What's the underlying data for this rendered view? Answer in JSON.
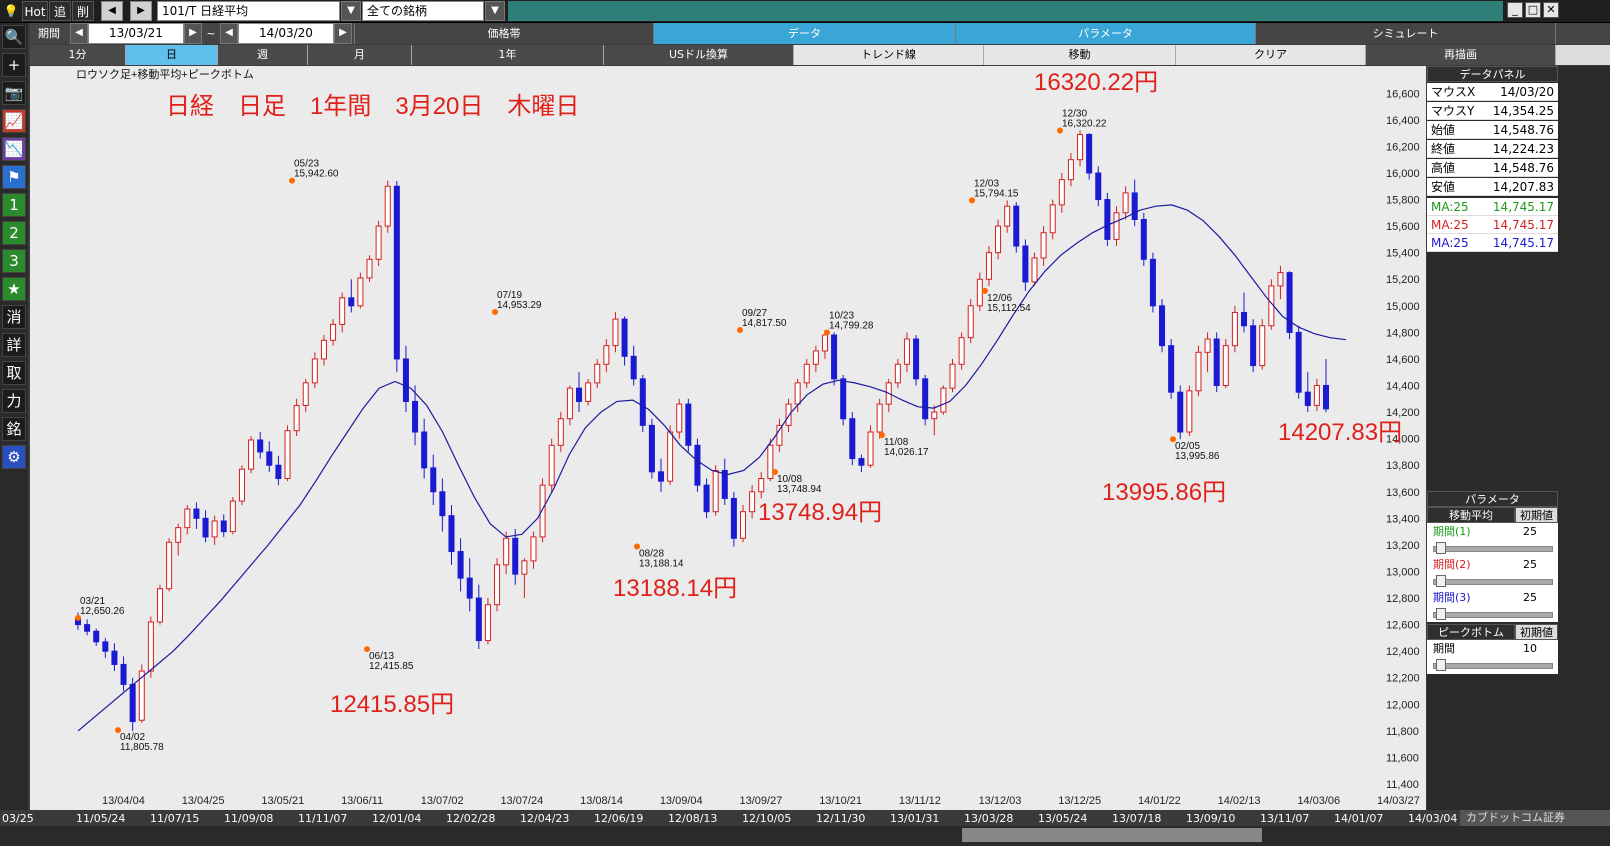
{
  "topbar": {
    "hot": "Hot",
    "add": "追",
    "del": "削",
    "symbol": "101/T 日経平均",
    "universe": "全ての銘柄"
  },
  "row2": {
    "period_label": "期間",
    "date_from": "13/03/21",
    "tilde": "~",
    "date_to": "14/03/20",
    "tabs": [
      "価格帯",
      "データ",
      "パラメータ",
      "シミュレート"
    ]
  },
  "row3": {
    "tabs": [
      "1分",
      "日",
      "週",
      "月",
      "1年",
      "USドル換算",
      "トレンド線",
      "移動",
      "クリア",
      "再描画"
    ]
  },
  "lefttool": {
    "buttons": [
      "search-icon",
      "plus-icon",
      "camera-icon",
      "chart-icon",
      "chart2-icon",
      "flag-icon",
      "1",
      "2",
      "3",
      "★",
      "消",
      "詳",
      "取",
      "力",
      "銘",
      "gear-icon"
    ]
  },
  "chart_data": {
    "type": "candlestick",
    "title": "ロウソク足+移動平均+ピークボトム",
    "headline": "日経　日足　1年間　3月20日　木曜日",
    "ylim": [
      11400,
      16700
    ],
    "y_ticks": [
      11400,
      11600,
      11800,
      12000,
      12200,
      12400,
      12600,
      12800,
      13000,
      13200,
      13400,
      13600,
      13800,
      14000,
      14200,
      14400,
      14600,
      14800,
      15000,
      15200,
      15400,
      15600,
      15800,
      16000,
      16200,
      16400,
      16600
    ],
    "y_tick_labels": [
      "11,400",
      "11,600",
      "11,800",
      "12,000",
      "12,200",
      "12,400",
      "12,600",
      "12,800",
      "13,000",
      "13,200",
      "13,400",
      "13,600",
      "13,800",
      "14,000",
      "14,200",
      "14,400",
      "14,600",
      "14,800",
      "15,000",
      "15,200",
      "15,400",
      "15,600",
      "15,800",
      "16,000",
      "16,200",
      "16,400",
      "16,600"
    ],
    "x_labels": [
      "13/04/04",
      "13/04/25",
      "13/05/21",
      "13/06/11",
      "13/07/02",
      "13/07/24",
      "13/08/14",
      "13/09/04",
      "13/09/27",
      "13/10/21",
      "13/11/12",
      "13/12/03",
      "13/12/25",
      "14/01/22",
      "14/02/13",
      "14/03/06",
      "14/03/27"
    ],
    "peaks": [
      {
        "date": "03/21",
        "value": "12,650.26",
        "kind": "peak"
      },
      {
        "date": "04/02",
        "value": "11,805.78",
        "kind": "bottom"
      },
      {
        "date": "05/23",
        "value": "15,942.60",
        "kind": "peak"
      },
      {
        "date": "06/13",
        "value": "12,415.85",
        "kind": "bottom"
      },
      {
        "date": "07/19",
        "value": "14,953.29",
        "kind": "peak"
      },
      {
        "date": "08/28",
        "value": "13,188.14",
        "kind": "bottom"
      },
      {
        "date": "09/27",
        "value": "14,817.50",
        "kind": "peak"
      },
      {
        "date": "10/08",
        "value": "13,748.94",
        "kind": "bottom"
      },
      {
        "date": "10/23",
        "value": "14,799.28",
        "kind": "peak"
      },
      {
        "date": "11/08",
        "value": "14,026.17",
        "kind": "bottom"
      },
      {
        "date": "12/03",
        "value": "15,794.15",
        "kind": "peak"
      },
      {
        "date": "12/06",
        "value": "15,112.54",
        "kind": "bottom"
      },
      {
        "date": "12/30",
        "value": "16,320.22",
        "kind": "peak"
      },
      {
        "date": "02/05",
        "value": "13,995.86",
        "kind": "bottom"
      }
    ],
    "annotations": [
      "16320.22円",
      "12415.85円",
      "13188.14円",
      "13748.94円",
      "13995.86円",
      "14207.83円"
    ],
    "ma_label": "MA:25",
    "colors": {
      "up": "#d42020",
      "down": "#1a1ad0",
      "ma": "#1a1aa0",
      "peak_dot": "#ff6a00",
      "annotation": "#e0201a"
    },
    "ohlc_series": [
      [
        12650,
        12690,
        12560,
        12600
      ],
      [
        12600,
        12640,
        12520,
        12550
      ],
      [
        12550,
        12570,
        12440,
        12470
      ],
      [
        12470,
        12500,
        12350,
        12400
      ],
      [
        12400,
        12460,
        12250,
        12300
      ],
      [
        12300,
        12360,
        12100,
        12150
      ],
      [
        12150,
        12200,
        11800,
        11870
      ],
      [
        11880,
        12300,
        11860,
        12250
      ],
      [
        12250,
        12660,
        12200,
        12620
      ],
      [
        12620,
        12900,
        12600,
        12870
      ],
      [
        12870,
        13250,
        12850,
        13220
      ],
      [
        13220,
        13360,
        13120,
        13330
      ],
      [
        13330,
        13500,
        13280,
        13470
      ],
      [
        13470,
        13520,
        13320,
        13400
      ],
      [
        13400,
        13460,
        13220,
        13260
      ],
      [
        13260,
        13420,
        13200,
        13380
      ],
      [
        13380,
        13430,
        13260,
        13300
      ],
      [
        13300,
        13560,
        13280,
        13530
      ],
      [
        13530,
        13800,
        13500,
        13770
      ],
      [
        13770,
        14020,
        13740,
        13990
      ],
      [
        13990,
        14050,
        13850,
        13900
      ],
      [
        13900,
        13980,
        13750,
        13800
      ],
      [
        13800,
        13870,
        13650,
        13700
      ],
      [
        13700,
        14100,
        13680,
        14060
      ],
      [
        14060,
        14300,
        14020,
        14250
      ],
      [
        14250,
        14450,
        14200,
        14420
      ],
      [
        14420,
        14650,
        14380,
        14600
      ],
      [
        14600,
        14780,
        14550,
        14740
      ],
      [
        14740,
        14900,
        14700,
        14860
      ],
      [
        14860,
        15100,
        14800,
        15060
      ],
      [
        15060,
        15200,
        14950,
        15000
      ],
      [
        15000,
        15250,
        14980,
        15210
      ],
      [
        15210,
        15380,
        15180,
        15350
      ],
      [
        15350,
        15640,
        15300,
        15600
      ],
      [
        15600,
        15942,
        15550,
        15900
      ],
      [
        15900,
        15940,
        14500,
        14600
      ],
      [
        14600,
        14700,
        14200,
        14280
      ],
      [
        14280,
        14400,
        13950,
        14050
      ],
      [
        14050,
        14150,
        13700,
        13780
      ],
      [
        13780,
        13880,
        13500,
        13600
      ],
      [
        13600,
        13700,
        13300,
        13420
      ],
      [
        13420,
        13500,
        13050,
        13150
      ],
      [
        13150,
        13250,
        12850,
        12950
      ],
      [
        12950,
        13100,
        12700,
        12800
      ],
      [
        12800,
        12900,
        12416,
        12480
      ],
      [
        12480,
        12800,
        12450,
        12750
      ],
      [
        12750,
        13100,
        12700,
        13050
      ],
      [
        13050,
        13300,
        12980,
        13250
      ],
      [
        13250,
        13320,
        12900,
        12980
      ],
      [
        12980,
        13100,
        12800,
        13080
      ],
      [
        13080,
        13300,
        13020,
        13260
      ],
      [
        13260,
        13700,
        13220,
        13650
      ],
      [
        13650,
        14000,
        13600,
        13950
      ],
      [
        13950,
        14200,
        13900,
        14150
      ],
      [
        14150,
        14400,
        14100,
        14380
      ],
      [
        14380,
        14500,
        14200,
        14280
      ],
      [
        14280,
        14450,
        14250,
        14420
      ],
      [
        14420,
        14600,
        14380,
        14560
      ],
      [
        14560,
        14750,
        14500,
        14700
      ],
      [
        14700,
        14953,
        14650,
        14900
      ],
      [
        14900,
        14920,
        14550,
        14620
      ],
      [
        14620,
        14700,
        14400,
        14450
      ],
      [
        14450,
        14480,
        14050,
        14100
      ],
      [
        14100,
        14150,
        13700,
        13750
      ],
      [
        13750,
        13850,
        13600,
        13680
      ],
      [
        13680,
        14100,
        13650,
        14050
      ],
      [
        14050,
        14300,
        14000,
        14260
      ],
      [
        14260,
        14300,
        13900,
        13950
      ],
      [
        13950,
        14000,
        13600,
        13650
      ],
      [
        13650,
        13700,
        13400,
        13450
      ],
      [
        13450,
        13800,
        13420,
        13760
      ],
      [
        13760,
        13850,
        13500,
        13550
      ],
      [
        13550,
        13600,
        13188,
        13250
      ],
      [
        13250,
        13500,
        13220,
        13450
      ],
      [
        13450,
        13650,
        13400,
        13600
      ],
      [
        13600,
        13750,
        13550,
        13700
      ],
      [
        13700,
        14000,
        13680,
        13950
      ],
      [
        13950,
        14150,
        13900,
        14100
      ],
      [
        14100,
        14300,
        14050,
        14260
      ],
      [
        14260,
        14450,
        14200,
        14420
      ],
      [
        14420,
        14600,
        14380,
        14560
      ],
      [
        14560,
        14700,
        14500,
        14660
      ],
      [
        14660,
        14817,
        14600,
        14780
      ],
      [
        14780,
        14800,
        14400,
        14450
      ],
      [
        14450,
        14480,
        14100,
        14150
      ],
      [
        14150,
        14200,
        13800,
        13850
      ],
      [
        13850,
        13880,
        13749,
        13800
      ],
      [
        13800,
        14100,
        13780,
        14050
      ],
      [
        14050,
        14300,
        14000,
        14260
      ],
      [
        14260,
        14450,
        14200,
        14420
      ],
      [
        14420,
        14600,
        14380,
        14560
      ],
      [
        14560,
        14799,
        14500,
        14750
      ],
      [
        14750,
        14780,
        14400,
        14450
      ],
      [
        14450,
        14480,
        14100,
        14150
      ],
      [
        14150,
        14250,
        14026,
        14200
      ],
      [
        14200,
        14400,
        14180,
        14380
      ],
      [
        14380,
        14600,
        14350,
        14560
      ],
      [
        14560,
        14800,
        14520,
        14760
      ],
      [
        14760,
        15050,
        14720,
        15000
      ],
      [
        15000,
        15250,
        14960,
        15200
      ],
      [
        15200,
        15450,
        15150,
        15400
      ],
      [
        15400,
        15650,
        15350,
        15600
      ],
      [
        15600,
        15794,
        15550,
        15750
      ],
      [
        15750,
        15780,
        15400,
        15450
      ],
      [
        15450,
        15500,
        15113,
        15180
      ],
      [
        15180,
        15400,
        15150,
        15360
      ],
      [
        15360,
        15600,
        15300,
        15550
      ],
      [
        15550,
        15800,
        15500,
        15760
      ],
      [
        15760,
        16000,
        15700,
        15950
      ],
      [
        15950,
        16150,
        15900,
        16100
      ],
      [
        16100,
        16320,
        16050,
        16290
      ],
      [
        16290,
        16300,
        15950,
        16000
      ],
      [
        16000,
        16050,
        15750,
        15800
      ],
      [
        15800,
        15850,
        15450,
        15500
      ],
      [
        15500,
        15750,
        15450,
        15700
      ],
      [
        15700,
        15900,
        15650,
        15850
      ],
      [
        15850,
        15950,
        15600,
        15650
      ],
      [
        15650,
        15700,
        15300,
        15350
      ],
      [
        15350,
        15400,
        14950,
        15000
      ],
      [
        15000,
        15050,
        14650,
        14700
      ],
      [
        14700,
        14750,
        14300,
        14350
      ],
      [
        14350,
        14400,
        13996,
        14050
      ],
      [
        14050,
        14400,
        14020,
        14360
      ],
      [
        14360,
        14700,
        14320,
        14650
      ],
      [
        14650,
        14800,
        14500,
        14750
      ],
      [
        14750,
        14800,
        14350,
        14400
      ],
      [
        14400,
        14750,
        14380,
        14700
      ],
      [
        14700,
        15000,
        14650,
        14950
      ],
      [
        14950,
        15100,
        14800,
        14850
      ],
      [
        14850,
        14900,
        14500,
        14550
      ],
      [
        14550,
        14900,
        14520,
        14850
      ],
      [
        14850,
        15200,
        14820,
        15150
      ],
      [
        15150,
        15300,
        15050,
        15250
      ],
      [
        15250,
        15260,
        14750,
        14800
      ],
      [
        14800,
        14850,
        14300,
        14350
      ],
      [
        14350,
        14500,
        14200,
        14250
      ],
      [
        14250,
        14450,
        14208,
        14400
      ],
      [
        14400,
        14600,
        14200,
        14224
      ]
    ],
    "ma_series": [
      11800,
      11900,
      12000,
      12100,
      12200,
      12300,
      12400,
      12520,
      12650,
      12780,
      12920,
      13060,
      13200,
      13350,
      13500,
      13680,
      13870,
      14050,
      14230,
      14380,
      14430,
      14380,
      14250,
      14050,
      13800,
      13560,
      13360,
      13260,
      13280,
      13400,
      13620,
      13880,
      14080,
      14200,
      14280,
      14290,
      14220,
      14100,
      13950,
      13840,
      13760,
      13730,
      13760,
      13860,
      14020,
      14200,
      14330,
      14410,
      14440,
      14420,
      14390,
      14350,
      14290,
      14240,
      14230,
      14280,
      14400,
      14560,
      14740,
      14930,
      15110,
      15260,
      15380,
      15470,
      15550,
      15610,
      15660,
      15720,
      15750,
      15760,
      15720,
      15640,
      15520,
      15380,
      15220,
      15060,
      14920,
      14840,
      14790,
      14760,
      14745
    ]
  },
  "data_panel": {
    "title": "データパネル",
    "rows": [
      {
        "k": "マウスX",
        "v": "14/03/20"
      },
      {
        "k": "マウスY",
        "v": "14,354.25"
      },
      {
        "k": "始値",
        "v": "14,548.76"
      },
      {
        "k": "終値",
        "v": "14,224.23"
      },
      {
        "k": "高値",
        "v": "14,548.76"
      },
      {
        "k": "安値",
        "v": "14,207.83"
      }
    ],
    "ma_rows": [
      {
        "k": "MA:25",
        "v": "14,745.17",
        "color": "#1a9a1a"
      },
      {
        "k": "MA:25",
        "v": "14,745.17",
        "color": "#d42020"
      },
      {
        "k": "MA:25",
        "v": "14,745.17",
        "color": "#1a1ad0"
      }
    ]
  },
  "param_panel": {
    "title": "パラメータ",
    "ma_header": "移動平均",
    "init_label": "初期値",
    "periods": [
      {
        "label": "期間(1)",
        "value": "25",
        "color": "#1a9a1a"
      },
      {
        "label": "期間(2)",
        "value": "25",
        "color": "#d42020"
      },
      {
        "label": "期間(3)",
        "value": "25",
        "color": "#1a1ad0"
      }
    ],
    "pb_header": "ピークボトム",
    "pb_init": "初期値",
    "pb_period_label": "期間",
    "pb_period_value": "10"
  },
  "bottombar": {
    "dates_top": [
      "03/25",
      "11/05/24",
      "11/07/15",
      "11/09/08",
      "11/11/07",
      "12/01/04",
      "12/02/28",
      "12/04/23",
      "12/06/19",
      "12/08/13",
      "12/10/05",
      "12/11/30",
      "13/01/31",
      "13/03/28",
      "13/05/24",
      "13/07/18",
      "13/09/10",
      "13/11/07",
      "14/01/07",
      "14/03/04"
    ],
    "brand": "カブドットコム証券"
  }
}
